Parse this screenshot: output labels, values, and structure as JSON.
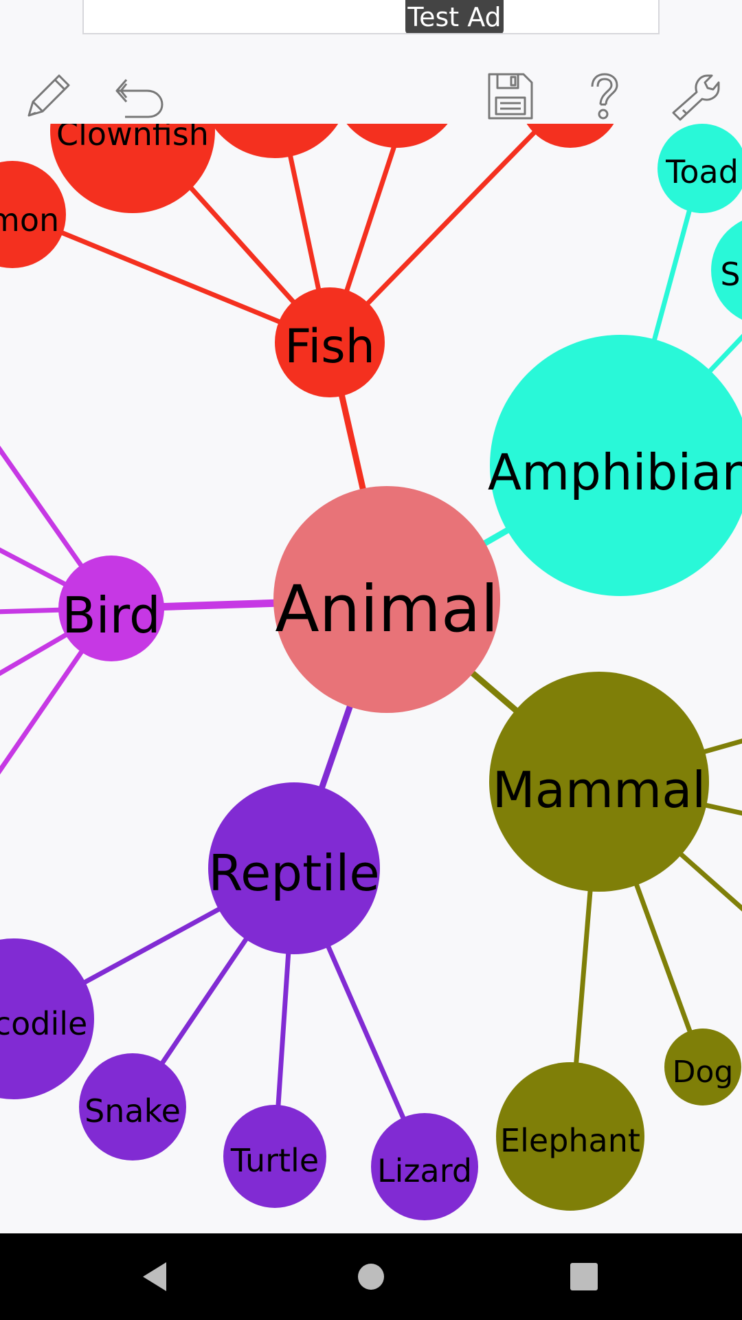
{
  "ad": {
    "label": "Test Ad"
  },
  "toolbar": {
    "pencil": "pencil-icon",
    "undo": "undo-icon",
    "save": "save-icon",
    "help": "help-icon",
    "settings": "wrench-icon"
  },
  "colors": {
    "root": "#e87378",
    "fish": "#f4301f",
    "amphibian": "#29f8d8",
    "bird": "#c638e4",
    "reptile": "#812bd3",
    "mammal": "#7f7f08"
  },
  "mindmap": {
    "root": "Animal",
    "fish": {
      "label": "Fish",
      "children": [
        "Clownfish",
        "Salmon"
      ]
    },
    "amphibian": {
      "label": "Amphibian",
      "children": [
        "Toad",
        "S"
      ]
    },
    "bird": {
      "label": "Bird"
    },
    "reptile": {
      "label": "Reptile",
      "children": [
        "Crocodile",
        "Snake",
        "Turtle",
        "Lizard"
      ]
    },
    "mammal": {
      "label": "Mammal",
      "children": [
        "Elephant",
        "Dog"
      ]
    }
  },
  "nav": {
    "back": "back-icon",
    "home": "home-icon",
    "recents": "recents-icon"
  }
}
